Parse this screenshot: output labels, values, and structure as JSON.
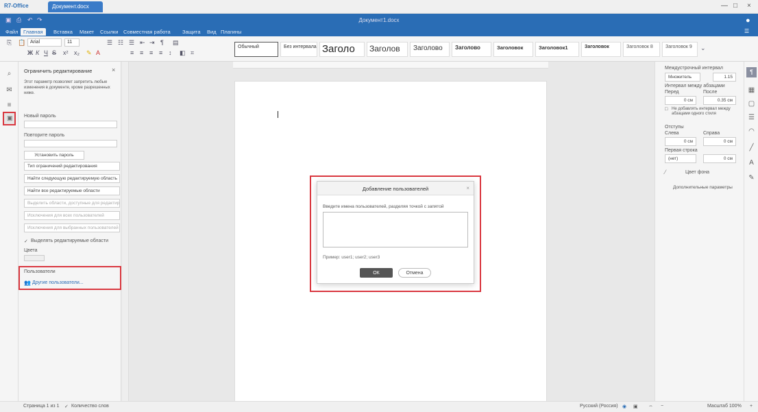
{
  "titlebar": {
    "app_name": "R7-Office",
    "doc_tab": "Документ.docx",
    "min": "—",
    "max": "□",
    "close": "×"
  },
  "header": {
    "title": "Документ1.docx",
    "icons": [
      "save-icon",
      "print-icon",
      "undo-icon",
      "redo-icon"
    ]
  },
  "menu": {
    "tabs": [
      "Файл",
      "Главная",
      "Вставка",
      "Макет",
      "Ссылки",
      "Совместная работа",
      "Защита",
      "Вид",
      "Плагины"
    ],
    "active_index": 1
  },
  "toolbar": {
    "font_name": "Arial",
    "font_size": "11",
    "styles": [
      "Обычный",
      "Без интервала",
      "Заголо",
      "Заголов",
      "Заголово",
      "Заголово",
      "Заголовок",
      "Заголовок1",
      "Заголовок",
      "Заголовок 8",
      "Заголовок 9"
    ]
  },
  "panel": {
    "title": "Ограничить редактирование",
    "description": "Этот параметр позволяет запретить любые изменения в документе, кроме разрешенных ниже.",
    "new_password_label": "Новый пароль",
    "confirm_password_label": "Повторите пароль",
    "set_password_button": "Установить пароль",
    "editing_types_label": "Тип ограничений редактирования",
    "find_next_button": "Найти следующую редактируемую область",
    "show_all_button": "Найти все редактируемые области",
    "hidden_button_1": "Выделить области, доступные для редактирования",
    "hidden_button_2": "Исключения для всех пользователей",
    "hidden_button_3": "Исключения для выбранных пользователей",
    "highlight_checkbox_label": "Выделять редактируемые области",
    "color_label": "Цвета",
    "users_title": "Пользователи",
    "users_link": "Другие пользователи..."
  },
  "dialog": {
    "title": "Добавление пользователей",
    "prompt": "Введите имена пользователей, разделяя точкой с запятой",
    "textarea_value": "",
    "example": "Пример: user1; user2; user3",
    "ok_label": "ОК",
    "cancel_label": "Отмена"
  },
  "rpanel": {
    "line_spacing_label": "Междустрочный интервал",
    "line_spacing_type": "Множитель",
    "line_spacing_value": "1.15",
    "paragraph_spacing_label": "Интервал между абзацами",
    "before_label": "Перед",
    "after_label": "После",
    "before_value": "0 см",
    "after_value": "0.35 см",
    "no_spacing_label": "Не добавлять интервал между абзацами одного стиля",
    "indents_label": "Отступы",
    "left_label": "Слева",
    "right_label": "Справа",
    "left_value": "0 см",
    "right_value": "0 см",
    "special_label": "Первая строка",
    "special_type": "(нет)",
    "special_value": "0 см",
    "bg_color_label": "Цвет фона",
    "advanced_label": "Дополнительные параметры"
  },
  "status": {
    "page": "Страница 1 из 1",
    "word_count": "Количество слов",
    "language": "Русский (Россия)",
    "zoom": "Масштаб 100%"
  },
  "colors": {
    "accent": "#2a6db5",
    "highlight": "#d9363e"
  }
}
